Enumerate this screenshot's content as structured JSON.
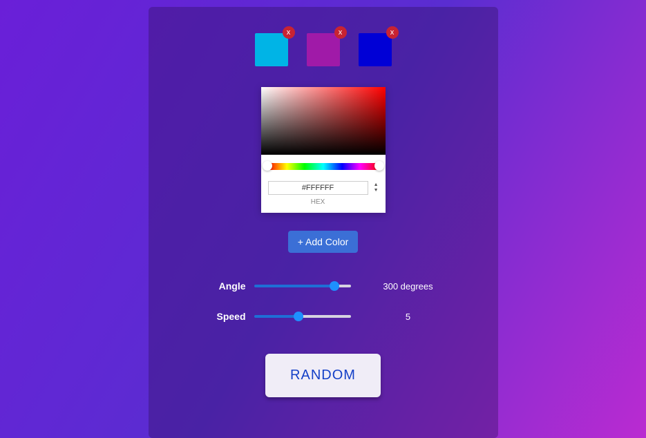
{
  "swatches": [
    {
      "color": "#00b4e6",
      "close": "x"
    },
    {
      "color": "#a01aa8",
      "close": "x"
    },
    {
      "color": "#0000d6",
      "close": "x"
    }
  ],
  "picker": {
    "hex_value": "#FFFFFF",
    "hex_label": "HEX"
  },
  "add_color_label": "+ Add Color",
  "sliders": {
    "angle": {
      "label": "Angle",
      "value_text": "300 degrees",
      "percent": 83
    },
    "speed": {
      "label": "Speed",
      "value_text": "5",
      "percent": 46
    }
  },
  "random_label": "RANDOM"
}
